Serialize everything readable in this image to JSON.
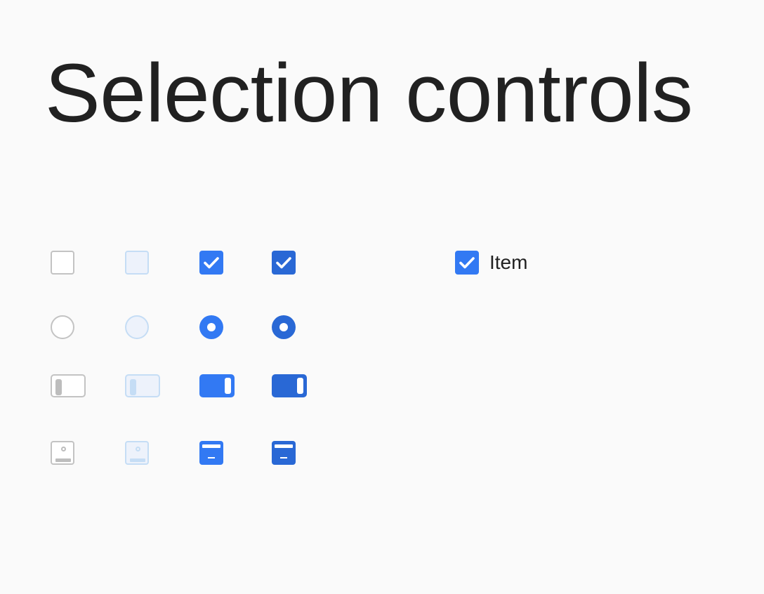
{
  "page": {
    "title": "Selection controls"
  },
  "example": {
    "label": "Item",
    "checked": true
  },
  "colors": {
    "background": "#fafafa",
    "text": "#212121",
    "accent": "#3279f3",
    "accent_pressed": "#2968d5",
    "unselected_border": "#c3c3c3",
    "disabled_fill": "#edf2fb",
    "disabled_border": "#c5ddf5"
  },
  "rows": [
    {
      "control": "checkbox",
      "states": [
        "unselected",
        "disabled",
        "selected",
        "selected-pressed"
      ]
    },
    {
      "control": "radio",
      "states": [
        "unselected",
        "disabled",
        "selected",
        "selected-pressed"
      ]
    },
    {
      "control": "switch",
      "states": [
        "off",
        "disabled",
        "on",
        "on-pressed"
      ]
    },
    {
      "control": "picture-select",
      "states": [
        "unselected",
        "disabled",
        "selected",
        "selected-pressed"
      ]
    }
  ],
  "icons": [
    "check-icon",
    "radio-dot-icon",
    "switch-knob-icon",
    "image-icon"
  ]
}
